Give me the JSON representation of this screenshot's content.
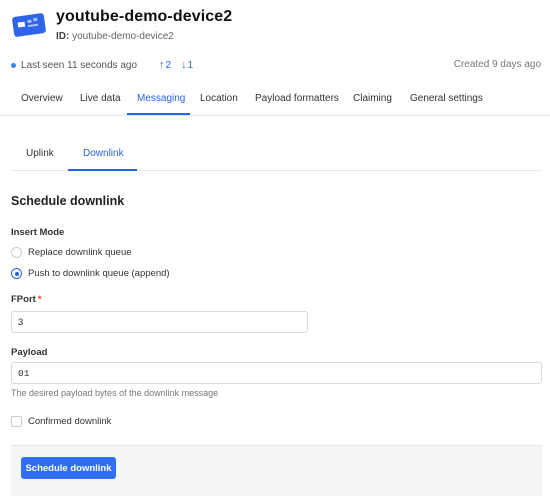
{
  "device": {
    "title": "youtube-demo-device2",
    "id_label": "ID:",
    "id_value": "youtube-demo-device2",
    "last_seen": "Last seen 11 seconds ago",
    "uplink_count": "2",
    "downlink_count": "1",
    "created": "Created 9 days ago"
  },
  "tabs": [
    {
      "label": "Overview"
    },
    {
      "label": "Live data"
    },
    {
      "label": "Messaging"
    },
    {
      "label": "Location"
    },
    {
      "label": "Payload formatters"
    },
    {
      "label": "Claiming"
    },
    {
      "label": "General settings"
    }
  ],
  "active_tab": "Messaging",
  "subtabs": [
    {
      "label": "Uplink"
    },
    {
      "label": "Downlink"
    }
  ],
  "active_subtab": "Downlink",
  "form": {
    "section_title": "Schedule downlink",
    "insert_mode_label": "Insert Mode",
    "insert_mode_options": [
      "Replace downlink queue",
      "Push to downlink queue (append)"
    ],
    "insert_mode_selected": "Push to downlink queue (append)",
    "fport_label": "FPort",
    "fport_required_mark": "*",
    "fport_value": "3",
    "payload_label": "Payload",
    "payload_value": "01",
    "payload_hint": "The desired payload bytes of the downlink message",
    "confirmed_label": "Confirmed downlink",
    "confirmed_checked": false,
    "submit_label": "Schedule downlink"
  },
  "colors": {
    "accent": "#2563eb",
    "button": "#2f6ef5",
    "footer_bg": "#f4f5f7"
  },
  "icons": {
    "device": "device-board-icon",
    "status": "status-dot-icon",
    "uplink": "arrow-up-icon",
    "downlink": "arrow-down-icon"
  }
}
